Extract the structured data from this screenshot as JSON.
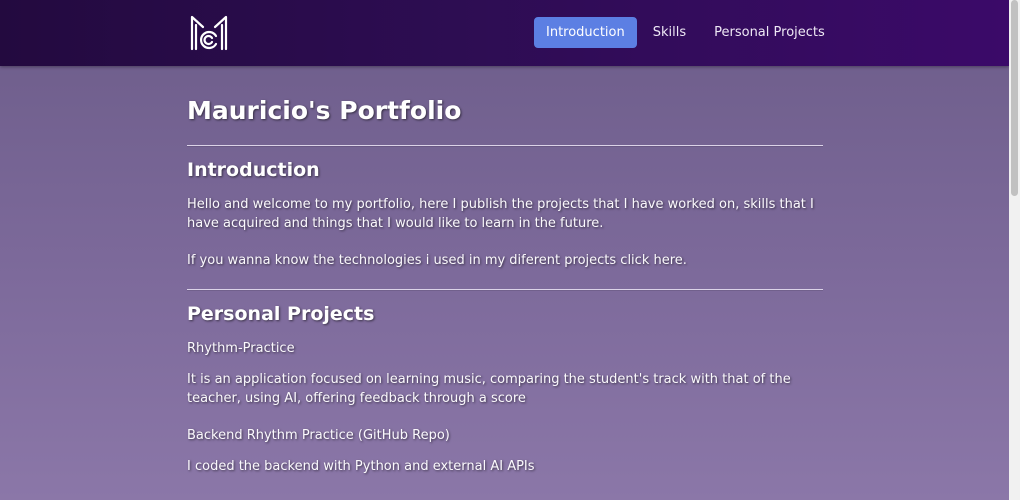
{
  "navbar": {
    "logo_icon": "mc-monogram-icon",
    "links": [
      {
        "label": "Introduction",
        "active": true
      },
      {
        "label": "Skills",
        "active": false
      },
      {
        "label": "Personal Projects",
        "active": false
      }
    ]
  },
  "main": {
    "title": "Mauricio's Portfolio",
    "introduction": {
      "heading": "Introduction",
      "text": "Hello and welcome to my portfolio, here I publish the projects that I have worked on, skills that I have acquired and things that I would like to learn in the future.",
      "technologies_text": "If you wanna know the technologies i used in my diferent projects click here."
    },
    "projects": {
      "heading": "Personal Projects",
      "items": [
        {
          "title": "Rhythm-Practice",
          "description": "It is an application focused on learning music, comparing the student's track with that of the teacher, using AI, offering feedback through a score"
        },
        {
          "title": "Backend Rhythm Practice (GitHub Repo)",
          "description": "I coded the backend with Python and external AI APIs"
        }
      ]
    }
  },
  "colors": {
    "navbar_start": "#230a3f",
    "navbar_end": "#3b0a69",
    "active_nav": "#5c7fe3",
    "page_background": "#7d6a9b"
  }
}
